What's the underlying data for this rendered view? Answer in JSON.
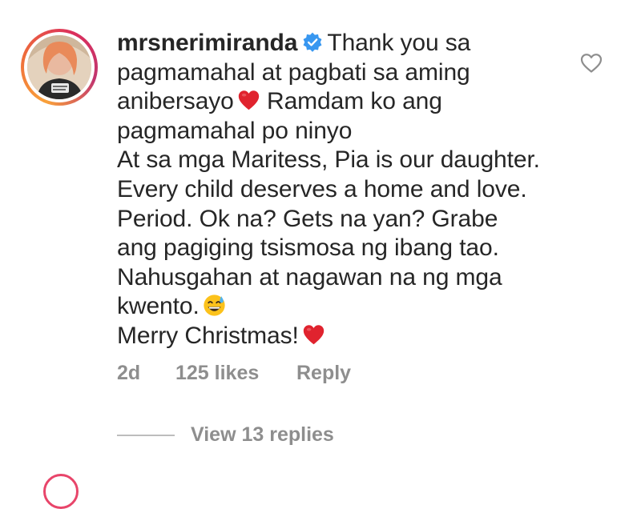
{
  "comment": {
    "username": "mrsnerimiranda",
    "verified": true,
    "lines": [
      "Thank you sa",
      "pagmamahal at pagbati sa aming",
      "anibersayo",
      "Ramdam ko ang",
      "pagmamahal po ninyo",
      "At sa mga Maritess, Pia is our daughter.",
      "Every child deserves a home and love.",
      "Period. Ok na? Gets na yan? Grabe",
      "ang pagiging tsismosa ng ibang tao.",
      "Nahusgahan at nagawan na ng mga",
      "kwento.",
      "Merry Christmas!"
    ],
    "emojis": {
      "heart": "red-heart-emoji",
      "smile": "grinning-sweat-emoji"
    },
    "timestamp": "2d",
    "likes": "125 likes",
    "reply_label": "Reply",
    "view_replies_label": "View 13 replies"
  },
  "colors": {
    "text": "#262626",
    "muted": "#8e8e8e",
    "heart": "#e0232e",
    "verified": "#3897f0",
    "story_ring": [
      "#f9a13a",
      "#dc2f5b"
    ]
  },
  "icons": {
    "like": "heart-outline-icon",
    "verified": "verified-badge-icon"
  }
}
